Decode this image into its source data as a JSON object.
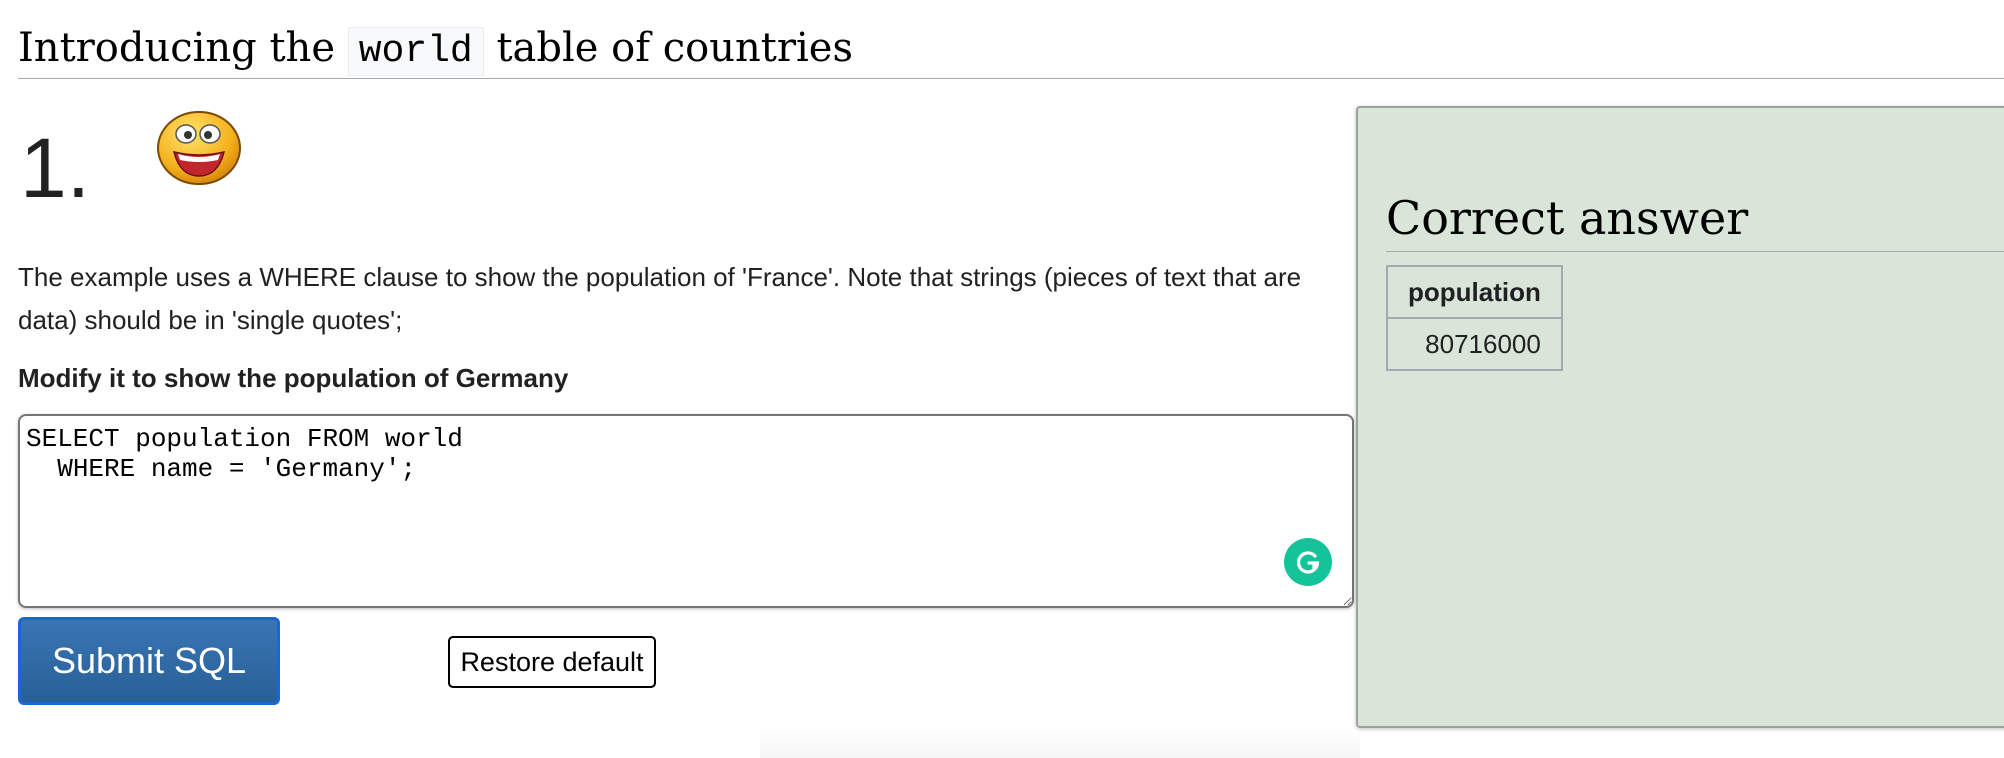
{
  "header": {
    "title_prefix": "Introducing the",
    "title_code": "world",
    "title_suffix": "table of countries"
  },
  "question": {
    "number": "1.",
    "emoji_icon": "smiley-icon",
    "description": "The example uses a WHERE clause to show the population of 'France'. Note that strings (pieces of text that are data) should be in 'single quotes';",
    "instruction": "Modify it to show the population of Germany"
  },
  "editor": {
    "sql": "SELECT population FROM world\n  WHERE name = 'Germany';",
    "assistant_icon": "grammarly-icon"
  },
  "actions": {
    "submit_label": "Submit SQL",
    "restore_label": "Restore default"
  },
  "answer": {
    "heading": "Correct answer",
    "columns": [
      "population"
    ],
    "rows": [
      [
        "80716000"
      ]
    ]
  },
  "colors": {
    "submit_button": "#285f96",
    "answer_panel": "#d9e5d9",
    "grammarly": "#15c39a"
  }
}
